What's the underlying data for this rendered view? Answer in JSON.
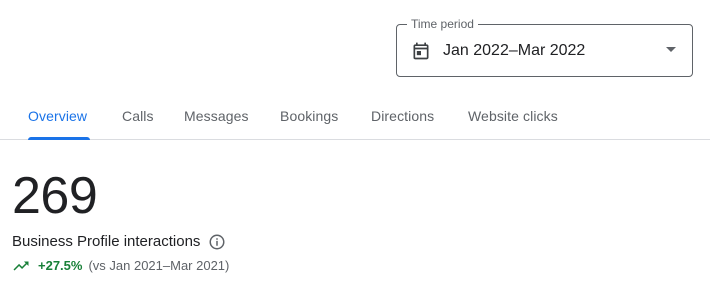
{
  "time_period": {
    "legend": "Time period",
    "value": "Jan 2022–Mar 2022",
    "calendar_icon": "calendar-icon",
    "dropdown_icon": "arrow-drop-down-icon"
  },
  "tabs": [
    {
      "label": "Overview",
      "active": true
    },
    {
      "label": "Calls",
      "active": false
    },
    {
      "label": "Messages",
      "active": false
    },
    {
      "label": "Bookings",
      "active": false
    },
    {
      "label": "Directions",
      "active": false
    },
    {
      "label": "Website clicks",
      "active": false
    }
  ],
  "metric": {
    "value": "269",
    "label": "Business Profile interactions",
    "info_icon": "info-icon",
    "change": "+27.5%",
    "comparison": "(vs Jan 2021–Mar 2021)",
    "trend_icon": "trending-up-icon"
  },
  "colors": {
    "accent": "#1a73e8",
    "positive": "#188038",
    "text_primary": "#202124",
    "text_secondary": "#5f6368",
    "divider": "#dadce0"
  }
}
